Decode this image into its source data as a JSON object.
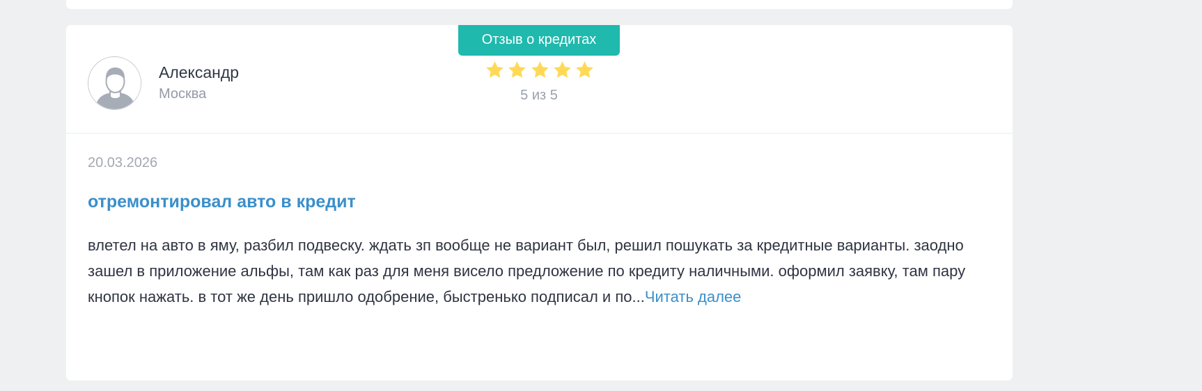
{
  "review": {
    "badge": "Отзыв о кредитах",
    "author": {
      "name": "Александр",
      "city": "Москва",
      "avatar_icon": "user-silhouette-icon"
    },
    "rating": {
      "value": 5,
      "max": 5,
      "text": "5 из 5",
      "star_icon": "star-icon"
    },
    "date": "20.03.2026",
    "title": "отремонтировал авто в кредит",
    "body": "влетел на авто в яму, разбил подвеску. ждать зп вообще не вариант был, решил пошукать за кредитные варианты. заодно зашел в приложение альфы, там как раз для меня висело предложение по кредиту наличными. оформил заявку, там пару кнопок нажать. в тот же день пришло одобрение, быстренько подписал и по...",
    "read_more": "Читать далее"
  },
  "colors": {
    "page_background": "#eff0f2",
    "card_background": "#ffffff",
    "badge": "#1fb9ad",
    "link": "#3a8fca",
    "star": "#ffd957"
  }
}
